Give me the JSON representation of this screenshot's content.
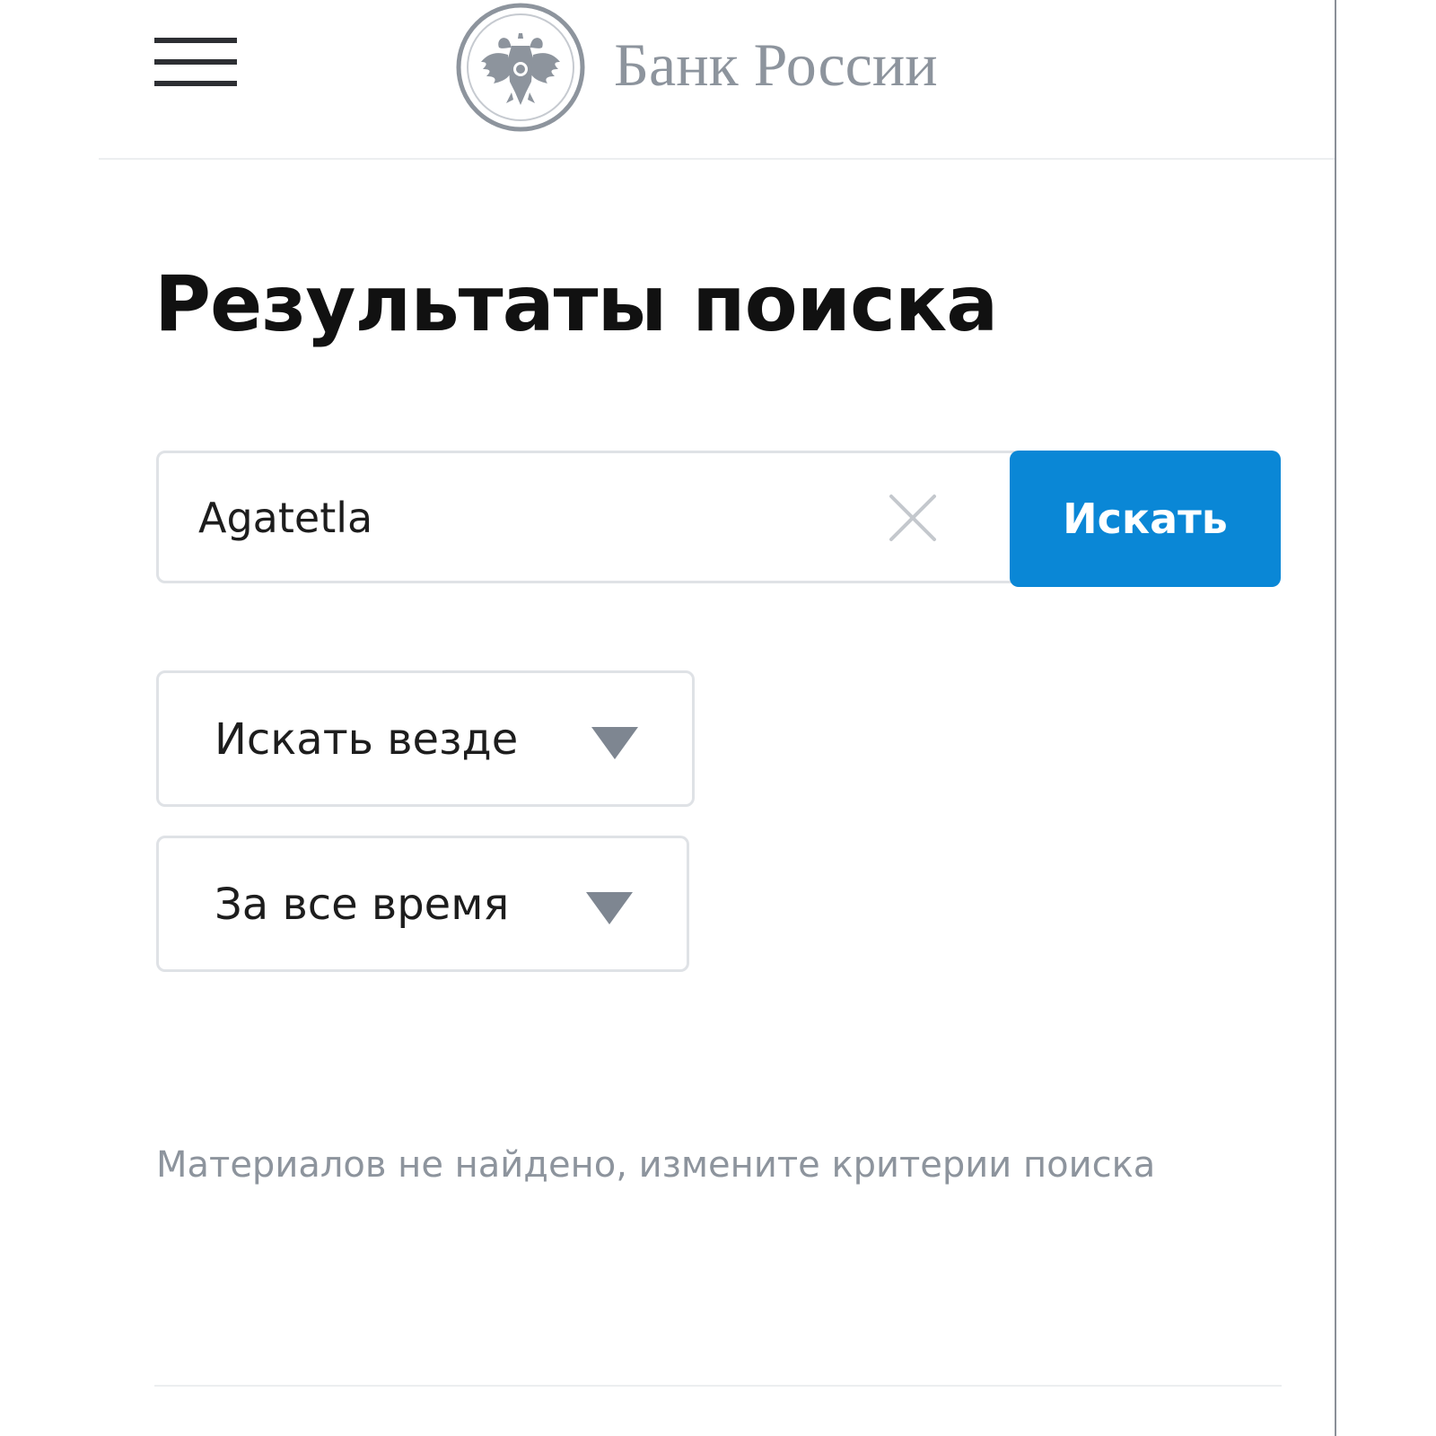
{
  "header": {
    "logo_text": "Банк России",
    "emblem_icon": "double-headed-eagle-emblem",
    "menu_icon": "hamburger-menu-icon"
  },
  "page": {
    "title": "Результаты поиска"
  },
  "search": {
    "query": "Agatetla",
    "clear_icon": "close-icon",
    "button_label": "Искать"
  },
  "filters": {
    "scope": {
      "selected": "Искать везде",
      "icon": "caret-down-icon"
    },
    "period": {
      "selected": "За все время",
      "icon": "caret-down-icon"
    }
  },
  "results": {
    "empty_message": "Материалов не найдено, измените критерии поиска"
  },
  "colors": {
    "accent": "#0a87d6",
    "muted_text": "#8d949d",
    "border": "#dfe2e6",
    "title_text": "#111111"
  }
}
